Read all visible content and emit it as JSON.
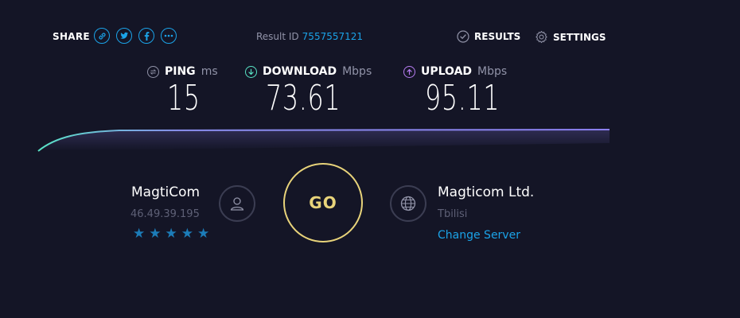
{
  "header": {
    "share_label": "SHARE",
    "share_icons": [
      "link-icon",
      "twitter-icon",
      "facebook-icon",
      "more-icon"
    ],
    "result_id_label": "Result ID",
    "result_id_value": "7557557121",
    "results_label": "RESULTS",
    "settings_label": "SETTINGS"
  },
  "metrics": {
    "ping": {
      "label": "PING",
      "unit": "ms",
      "value": "15",
      "color": "#9193a8"
    },
    "download": {
      "label": "DOWNLOAD",
      "unit": "Mbps",
      "value": "73.61",
      "color": "#58e3c5"
    },
    "upload": {
      "label": "UPLOAD",
      "unit": "Mbps",
      "value": "95.11",
      "color": "#b57cf0"
    }
  },
  "isp": {
    "name": "MagtiCom",
    "ip": "46.49.39.195",
    "rating_stars": 5,
    "icon": "user-icon"
  },
  "go_label": "GO",
  "server": {
    "name": "Magticom Ltd.",
    "location": "Tbilisi",
    "change_label": "Change Server",
    "icon": "globe-icon"
  },
  "colors": {
    "background": "#141526",
    "accent_blue": "#1ba3e8",
    "go_yellow": "#e8d37a",
    "graph_start": "#58e3c5",
    "graph_end": "#8b7ff0"
  }
}
